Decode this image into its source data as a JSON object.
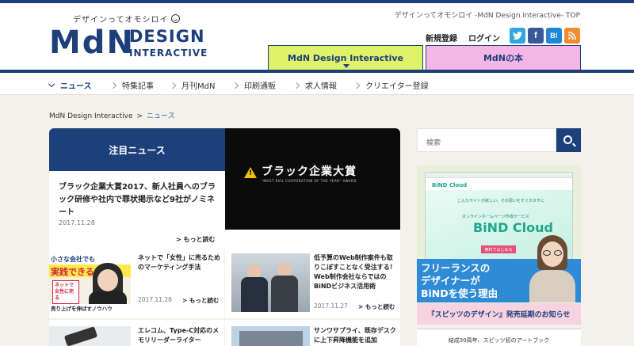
{
  "header": {
    "tagline": "デザインってオモシロイ",
    "logo_mdn": "MdN",
    "logo_design": "DESIGN",
    "logo_interactive": "INTERACTIVE",
    "site_title": "デザインってオモシロイ -MdN Design Interactive- TOP",
    "signup_label": "新規登録",
    "login_label": "ログイン",
    "social": [
      {
        "label": "t",
        "color": "#2ea6e0"
      },
      {
        "label": "f",
        "color": "#3b5998"
      },
      {
        "label": "B!",
        "color": "#1e88d6"
      },
      {
        "label": "rss",
        "color": "#f08b30"
      }
    ],
    "tabs": [
      "MdN Design Interactive",
      "MdNの本"
    ]
  },
  "nav": {
    "items": [
      "ニュース",
      "特集記事",
      "月刊MdN",
      "印刷通販",
      "求人情報",
      "クリエイター登録"
    ]
  },
  "breadcrumb": {
    "home": "MdN Design Interactive",
    "separator": ">",
    "current": "ニュース"
  },
  "featured": {
    "header": "注目ニュース",
    "title": "ブラック企業大賞2017、新人社員へのブラック研修や社内で罪状掲示など9社がノミネート",
    "date": "2017.11.28",
    "more": "> もっと読む",
    "image_text": "ブラック企業大賞",
    "image_subtext": "\"MOST EVIL CORPORATION OF THE YEAR\" AWARD"
  },
  "cards": [
    {
      "title": "ネットで「女性」に売るためのマーケティング手法",
      "date": "2017.11.28",
      "more": "> もっと読む",
      "image_text_top": "小さな会社でも",
      "image_text_mid": "実践できる!",
      "image_text_bottom": "売り上げを伸ばすノウハウ",
      "image_book": "ネットで女性に売る"
    },
    {
      "title": "低予算のWeb制作案件も取りこぼすことなく受注する！Web制作会社ならではのBiNDビジネス活用術",
      "date": "2017.11.27",
      "more": "> もっと読む"
    },
    {
      "title": "エレコム、Type-C対応のメモリリーダーライター"
    },
    {
      "title": "サンワサプライ、既存デスクに上下昇降機能を追加"
    }
  ],
  "sidebar": {
    "search_placeholder": "検索",
    "ad_logo": "BiND Cloud",
    "ad_copy": "こんなサイトが欲しい、その思いをすぐカタチに",
    "ad_subcopy": "オンラインホームページ作成サービス",
    "ad_bind": "BiND Cloud",
    "ad_button": "無料ではじめる",
    "ad_headline": "フリーランスの\nデザイナーが\nBiNDを使う理由",
    "pink_notice": "『スピッツのデザイン』発売延期のお知らせ",
    "book_text": "結成30周年、スピッツ初のアートブック"
  }
}
